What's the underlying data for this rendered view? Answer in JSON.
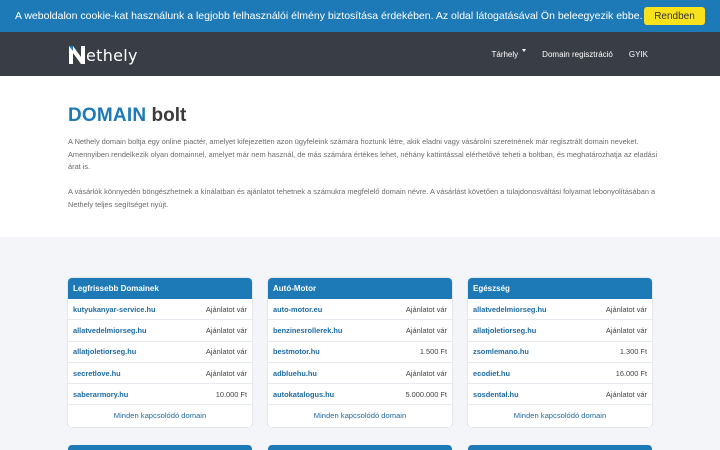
{
  "cookie": {
    "text": "A weboldalon cookie-kat használunk a legjobb felhasználói élmény biztosítása érdekében. Az oldal látogatásával Ön beleegyezik ebbe.",
    "button": "Rendben"
  },
  "nav": {
    "logo_text": "ethely",
    "items": [
      "Tárhely",
      "Domain regisztráció",
      "GYIK"
    ]
  },
  "intro": {
    "title_highlight": "DOMAIN",
    "title_rest": "bolt",
    "p1": "A Nethely domain boltja egy online piactér, amelyet kifejezetten azon ügyfeleink számára hoztunk létre, akik eladni vagy vásárolni szeretnének már regisztrált domain neveket. Amennyiben rendelkezik olyan domainnel, amelyet már nem használ, de más számára értékes lehet, néhány kattintással elérhetővé teheti a boltban, és meghatározhatja az eladási árat is.",
    "p2": "A vásárlók könnyedén böngészhetnek a kínálatban és ajánlatot tehetnek a számukra megfelelő domain névre. A vásárlást követően a tulajdonosváltási folyamat lebonyolításában a Nethely teljes segítséget nyújt."
  },
  "cards": [
    {
      "title": "Legfrissebb Domainek",
      "rows": [
        {
          "domain": "kutyukanyar-service.hu",
          "price": "Ajánlatot vár"
        },
        {
          "domain": "allatvedelmiorseg.hu",
          "price": "Ajánlatot vár"
        },
        {
          "domain": "allatjoletiorseg.hu",
          "price": "Ajánlatot vár"
        },
        {
          "domain": "secretlove.hu",
          "price": "Ajánlatot vár"
        },
        {
          "domain": "saberarmory.hu",
          "price": "10.000 Ft"
        }
      ],
      "footer": "Minden kapcsolódó domain"
    },
    {
      "title": "Autó-Motor",
      "rows": [
        {
          "domain": "auto-motor.eu",
          "price": "Ajánlatot vár"
        },
        {
          "domain": "benzinesrollerek.hu",
          "price": "Ajánlatot vár"
        },
        {
          "domain": "bestmotor.hu",
          "price": "1.500 Ft"
        },
        {
          "domain": "adbluehu.hu",
          "price": "Ajánlatot vár"
        },
        {
          "domain": "autokatalogus.hu",
          "price": "5.000.000 Ft"
        }
      ],
      "footer": "Minden kapcsolódó domain"
    },
    {
      "title": "Egészség",
      "rows": [
        {
          "domain": "allatvedelmiorseg.hu",
          "price": "Ajánlatot vár"
        },
        {
          "domain": "allatjoletiorseg.hu",
          "price": "Ajánlatot vár"
        },
        {
          "domain": "zsomlemano.hu",
          "price": "1.300 Ft"
        },
        {
          "domain": "ecodiet.hu",
          "price": "16.000 Ft"
        },
        {
          "domain": "sosdental.hu",
          "price": "Ajánlatot vár"
        }
      ],
      "footer": "Minden kapcsolódó domain"
    }
  ],
  "colors": {
    "primary": "#1d7ab6",
    "navbar": "#393d45",
    "cookie_button": "#f7e21c"
  }
}
